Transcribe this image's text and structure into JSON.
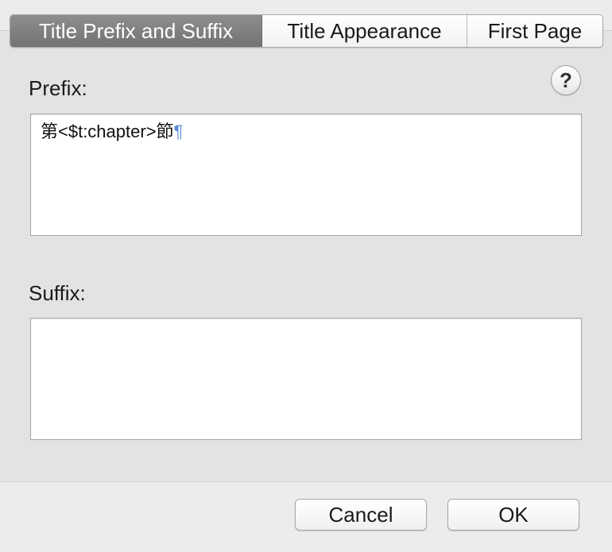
{
  "tabs": [
    {
      "label": "Title Prefix and Suffix",
      "active": true
    },
    {
      "label": "Title Appearance",
      "active": false
    },
    {
      "label": "First Page",
      "active": false
    }
  ],
  "prefix": {
    "label": "Prefix:",
    "value": "第<$t:chapter>節",
    "pilcrow": "¶"
  },
  "suffix": {
    "label": "Suffix:",
    "value": ""
  },
  "help": {
    "glyph": "?"
  },
  "buttons": {
    "cancel": "Cancel",
    "ok": "OK"
  },
  "colors": {
    "active_tab": "#7f7f7f",
    "pilcrow": "#5b8ad9"
  }
}
